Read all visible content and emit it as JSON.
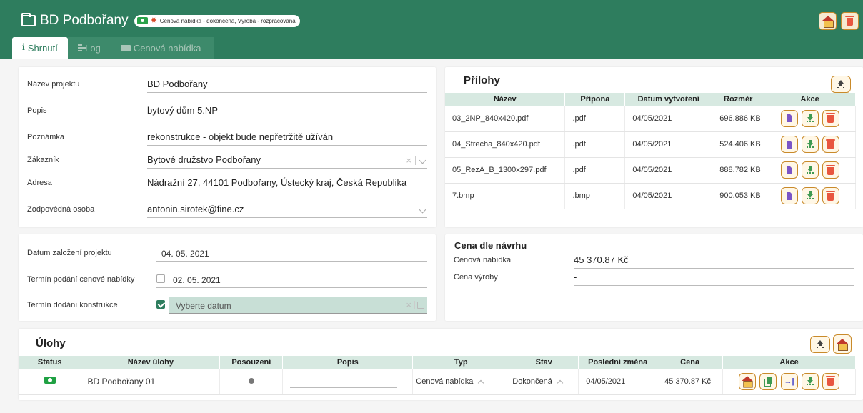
{
  "header": {
    "title": "BD Podbořany",
    "status_text": "Cenová nabídka - dokončená, Výroba - rozpracovaná",
    "bg_color": "#2e7d5e"
  },
  "tabs": [
    {
      "label": "Shrnutí",
      "active": true
    },
    {
      "label": "Log",
      "active": false
    },
    {
      "label": "Cenová nabídka",
      "active": false
    }
  ],
  "project": {
    "name_label": "Název projektu",
    "name_value": "BD Podbořany",
    "desc_label": "Popis",
    "desc_value": "bytový dům 5.NP",
    "note_label": "Poznámka",
    "note_value": "rekonstrukce - objekt bude nepřetržitě užíván",
    "customer_label": "Zákazník",
    "customer_value": "Bytové družstvo Podbořany",
    "address_label": "Adresa",
    "address_value": "Nádražní 27, 44101 Podbořany, Ústecký kraj, Česká Republika",
    "responsible_label": "Zodpovědná osoba",
    "responsible_value": "antonin.sirotek@fine.cz"
  },
  "dates": {
    "created_label": "Datum založení projektu",
    "created_value": "04. 05. 2021",
    "offer_label": "Termín podání cenové nabídky",
    "offer_value": "02. 05. 2021",
    "offer_checked": false,
    "delivery_label": "Termín dodání konstrukce",
    "delivery_placeholder": "Vyberte datum",
    "delivery_checked": true
  },
  "attachments": {
    "title": "Přílohy",
    "columns": [
      "Název",
      "Přípona",
      "Datum vytvoření",
      "Rozměr",
      "Akce"
    ],
    "rows": [
      {
        "name": "03_2NP_840x420.pdf",
        "ext": ".pdf",
        "date": "04/05/2021",
        "size": "696.886 KB"
      },
      {
        "name": "04_Strecha_840x420.pdf",
        "ext": ".pdf",
        "date": "04/05/2021",
        "size": "524.406 KB"
      },
      {
        "name": "05_RezA_B_1300x297.pdf",
        "ext": ".pdf",
        "date": "04/05/2021",
        "size": "888.782 KB"
      },
      {
        "name": "7.bmp",
        "ext": ".bmp",
        "date": "04/05/2021",
        "size": "900.053 KB"
      }
    ]
  },
  "price": {
    "title": "Cena dle návrhu",
    "offer_label": "Cenová nabídka",
    "offer_value": "45 370.87 Kč",
    "production_label": "Cena výroby",
    "production_value": "-"
  },
  "tasks": {
    "title": "Úlohy",
    "columns": [
      "Status",
      "Název úlohy",
      "Posouzení",
      "Popis",
      "Typ",
      "Stav",
      "Poslední změna",
      "Cena",
      "Akce"
    ],
    "rows": [
      {
        "name": "BD Podbořany 01",
        "desc": "",
        "type": "Cenová nabídka",
        "state": "Dokončená",
        "changed": "04/05/2021",
        "price": "45 370.87 Kč"
      }
    ]
  },
  "icons": {
    "accent": "#c98a2a",
    "delete": "#e8563f",
    "download": "#3f9a52",
    "document": "#7b55c7"
  }
}
